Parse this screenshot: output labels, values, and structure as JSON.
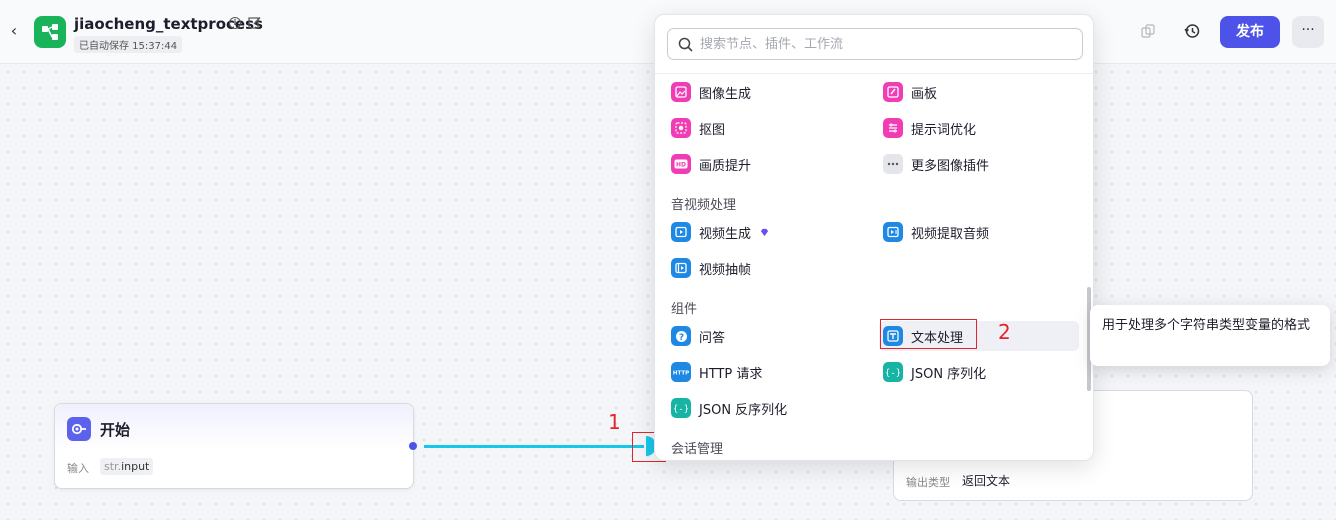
{
  "header": {
    "back_icon": "chevron-left-icon",
    "app_icon": "workflow-icon",
    "brand_color": "#19b45a",
    "title": "jiaocheng_textprocess",
    "autosave": "已自动保存 15:37:44",
    "publish_label": "发布",
    "more_label": "···",
    "accent_color": "#4d53e8"
  },
  "canvas": {
    "start_node": {
      "title": "开始",
      "input_label": "输入",
      "input_type": "str.",
      "input_name": "input"
    },
    "end_node": {
      "output_type_label": "输出类型",
      "output_type_value": "返回文本"
    },
    "annotation_1": "1",
    "annotation_2": "2",
    "connector_color": "#17c6e8",
    "annotation_color": "#e5232a"
  },
  "picker": {
    "search_placeholder": "搜索节点、插件、工作流",
    "image_items": [
      {
        "label": "图像生成",
        "icon": "image-generate-icon"
      },
      {
        "label": "画板",
        "icon": "canvas-board-icon"
      },
      {
        "label": "抠图",
        "icon": "cutout-icon"
      },
      {
        "label": "提示词优化",
        "icon": "prompt-optimize-icon"
      },
      {
        "label": "画质提升",
        "icon": "hd-upscale-icon"
      },
      {
        "label": "更多图像插件",
        "icon": "more-dots-icon"
      }
    ],
    "av_section_title": "音视频处理",
    "av_items": [
      {
        "label": "视频生成",
        "icon": "video-generate-icon",
        "badge": "premium-diamond-icon"
      },
      {
        "label": "视频提取音频",
        "icon": "video-audio-extract-icon"
      },
      {
        "label": "视频抽帧",
        "icon": "video-frame-icon"
      }
    ],
    "component_section_title": "组件",
    "component_items": [
      {
        "label": "问答",
        "icon": "question-icon"
      },
      {
        "label": "文本处理",
        "icon": "text-process-icon"
      },
      {
        "label": "HTTP 请求",
        "icon": "http-icon"
      },
      {
        "label": "JSON 序列化",
        "icon": "json-serialize-icon"
      },
      {
        "label": "JSON 反序列化",
        "icon": "json-deserialize-icon"
      }
    ],
    "session_section_title": "会话管理"
  },
  "tooltip": {
    "text": "用于处理多个字符串类型变量的格式"
  }
}
